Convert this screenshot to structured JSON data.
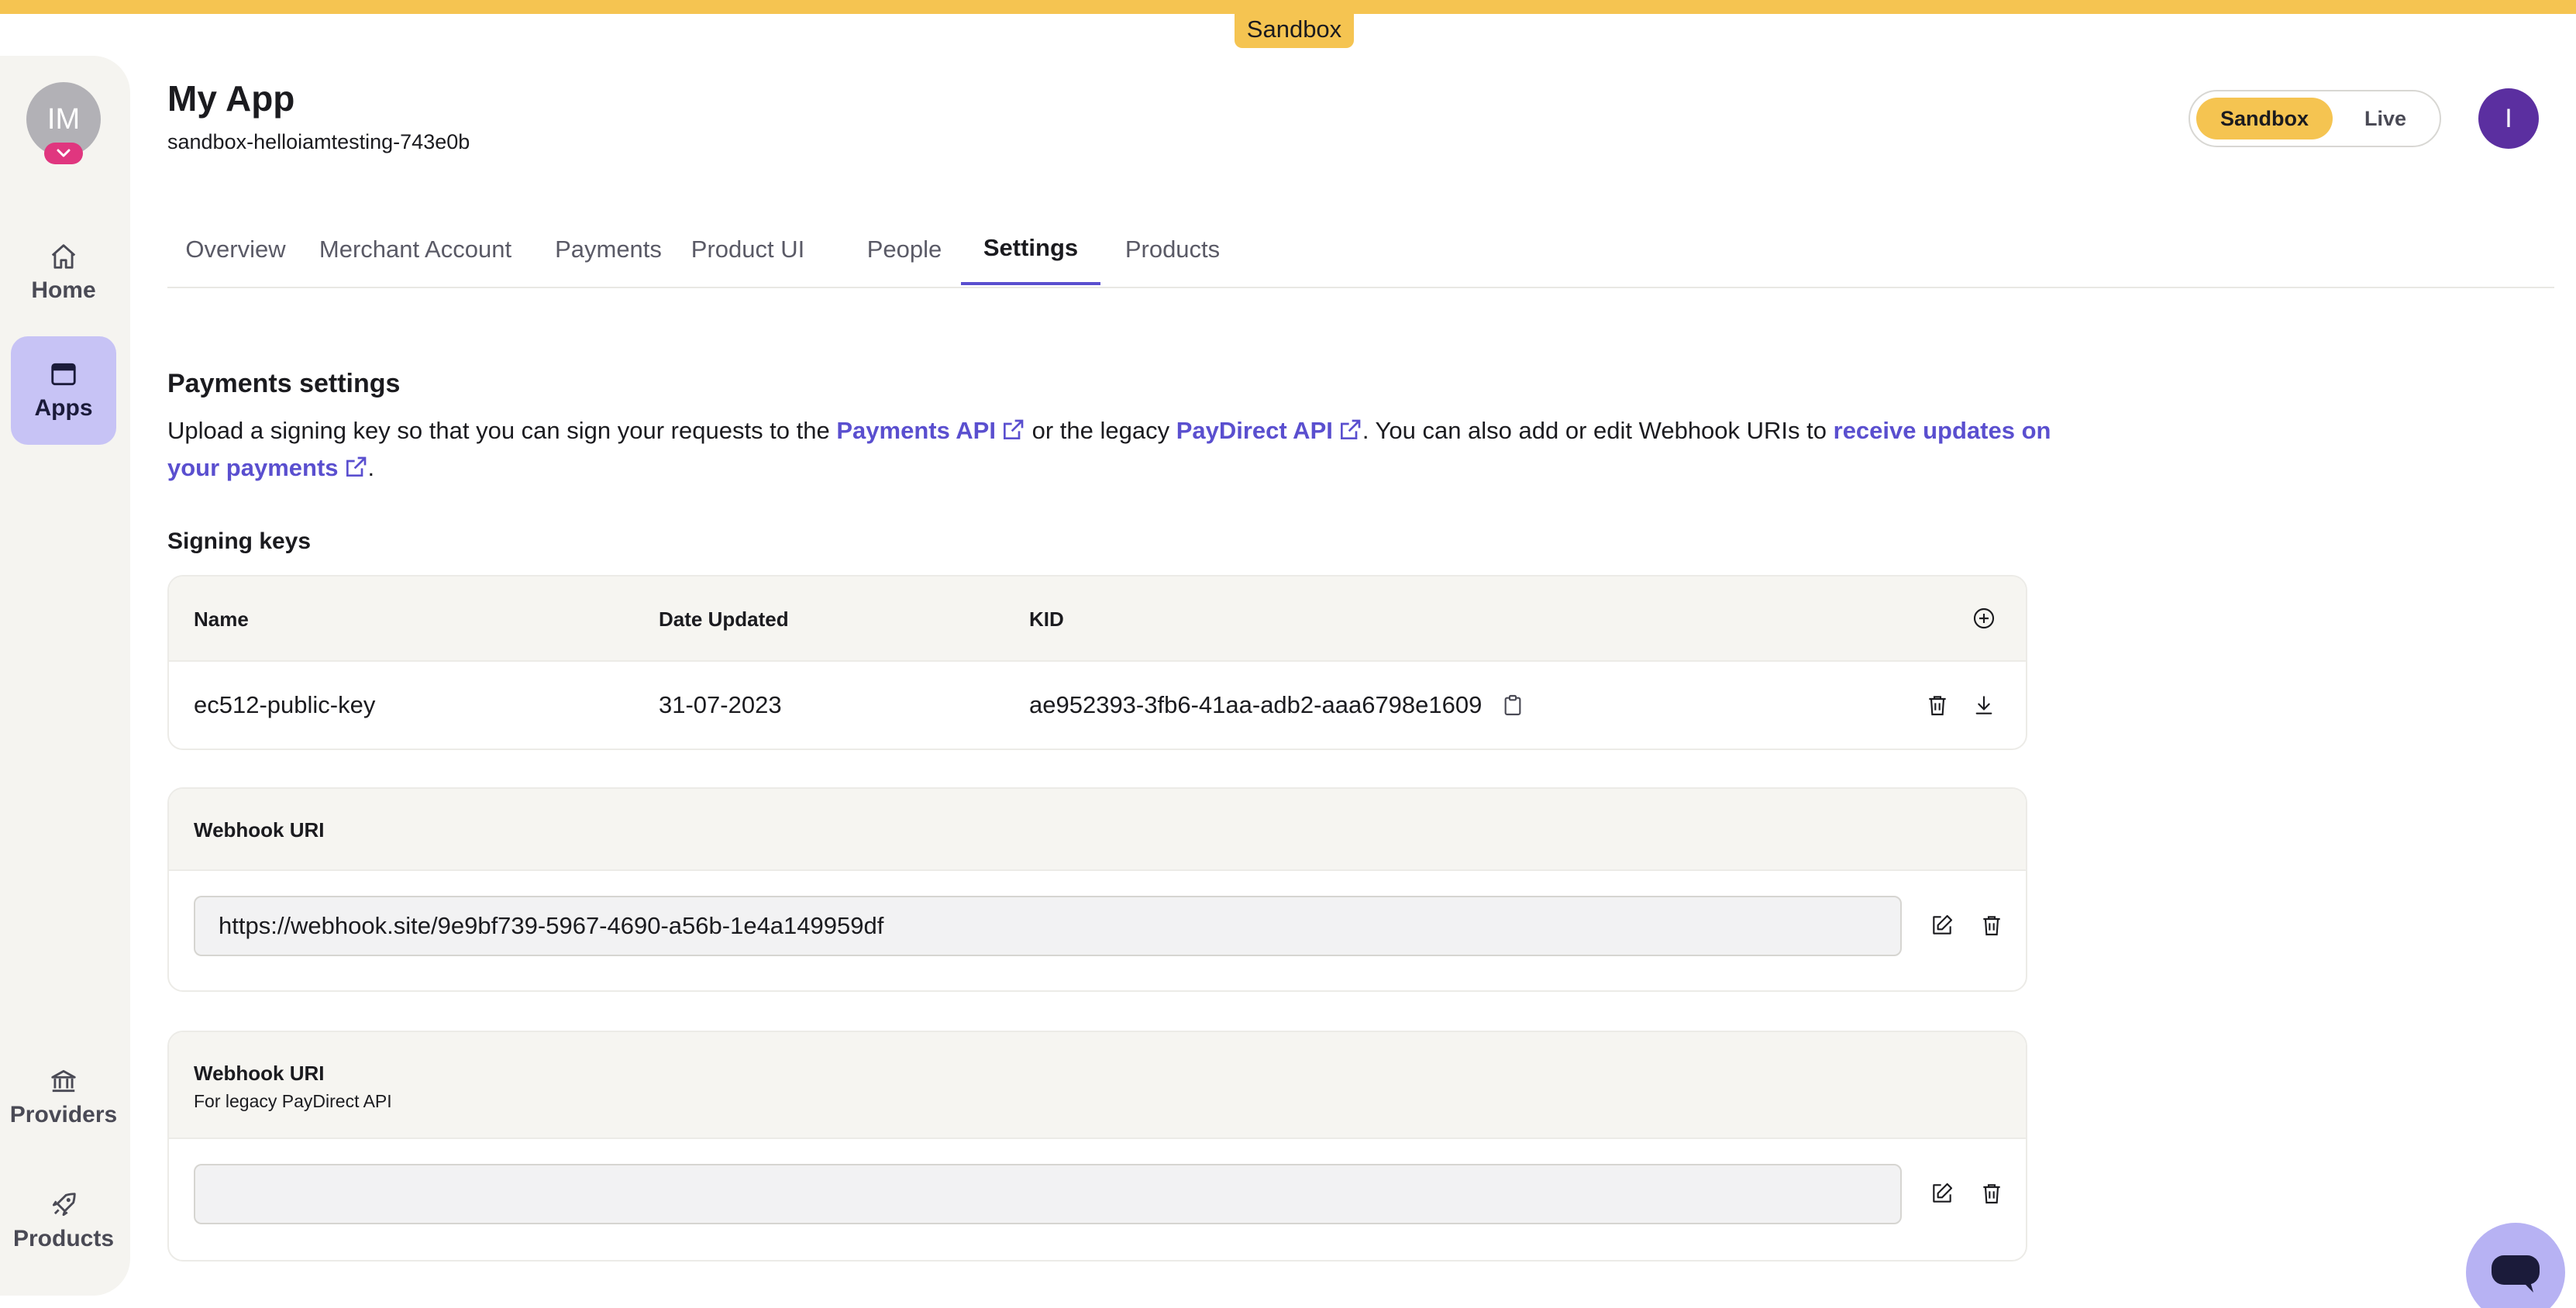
{
  "environment_banner": "Sandbox",
  "sidebar": {
    "org_initials": "IM",
    "items": [
      {
        "label": "Home",
        "icon": "home-icon"
      },
      {
        "label": "Apps",
        "icon": "window-icon",
        "active": true
      },
      {
        "label": "Providers",
        "icon": "bank-icon"
      },
      {
        "label": "Products",
        "icon": "rocket-icon"
      }
    ]
  },
  "header": {
    "title": "My App",
    "app_id": "sandbox-helloiamtesting-743e0b",
    "env_toggle": {
      "sandbox": "Sandbox",
      "live": "Live",
      "selected": "Sandbox"
    },
    "user_initial": "I"
  },
  "tabs": [
    {
      "label": "Overview"
    },
    {
      "label": "Merchant Account"
    },
    {
      "label": "Payments"
    },
    {
      "label": "Product UI"
    },
    {
      "label": "People"
    },
    {
      "label": "Settings",
      "active": true
    },
    {
      "label": "Products"
    }
  ],
  "payments_settings": {
    "title": "Payments settings",
    "desc_part1": "Upload a signing key so that you can sign your requests to the ",
    "link_payments_api": "Payments API",
    "desc_part2": " or the legacy ",
    "link_paydirect_api": "PayDirect API",
    "desc_part3": ". You can also add or edit Webhook URIs to ",
    "link_receive_updates": "receive updates on your payments",
    "desc_part4": "."
  },
  "signing_keys": {
    "title": "Signing keys",
    "columns": [
      "Name",
      "Date Updated",
      "KID"
    ],
    "rows": [
      {
        "name": "ec512-public-key",
        "date": "31-07-2023",
        "kid": "ae952393-3fb6-41aa-adb2-aaa6798e1609"
      }
    ]
  },
  "webhook": {
    "title": "Webhook URI",
    "value": "https://webhook.site/9e9bf739-5967-4690-a56b-1e4a149959df"
  },
  "legacy_webhook": {
    "title": "Webhook URI",
    "subtitle": "For legacy PayDirect API",
    "value": ""
  },
  "colors": {
    "accent": "#5a4fcf",
    "sandbox": "#f5c451",
    "active_nav": "#c7c3f5",
    "avatar": "#5b2fa0"
  }
}
